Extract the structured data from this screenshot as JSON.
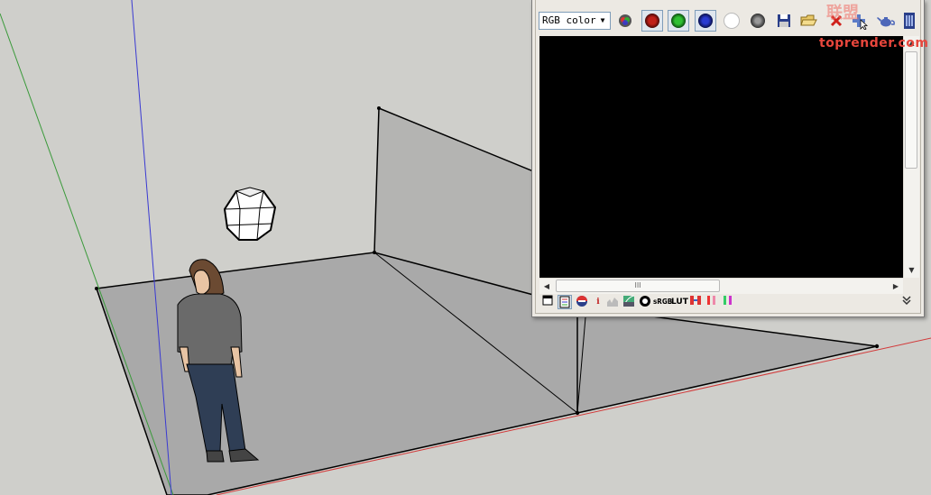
{
  "frame_buffer": {
    "channel_select": {
      "value": "RGB color"
    },
    "toolbar_buttons": [
      {
        "name": "rgb-channels-icon"
      },
      {
        "name": "red-channel-icon",
        "color": "#c0201a"
      },
      {
        "name": "green-channel-icon",
        "color": "#1c9a25"
      },
      {
        "name": "blue-channel-icon",
        "color": "#1b2a9a"
      },
      {
        "name": "alpha-channel-icon"
      },
      {
        "name": "monochrome-icon"
      },
      {
        "name": "save-image-icon"
      },
      {
        "name": "load-image-icon"
      },
      {
        "name": "clear-image-icon"
      },
      {
        "name": "track-mouse-icon"
      },
      {
        "name": "render-teapot-icon"
      },
      {
        "name": "expand-icon"
      }
    ],
    "bottom_toolbar": {
      "srgb_label": "sRGB",
      "lut_label": "LUT",
      "info_label": "i"
    },
    "hscroll_grip": "III"
  },
  "watermark": {
    "site": "toprender.com",
    "cn": "联盟"
  },
  "colors": {
    "viewport_bg": "#cfcfcb",
    "floor": "#a8a8a8",
    "wall": "#b3b3b1",
    "axis_red": "#d23a3a",
    "axis_green": "#3a9a3a",
    "axis_blue": "#3a3ad2"
  }
}
